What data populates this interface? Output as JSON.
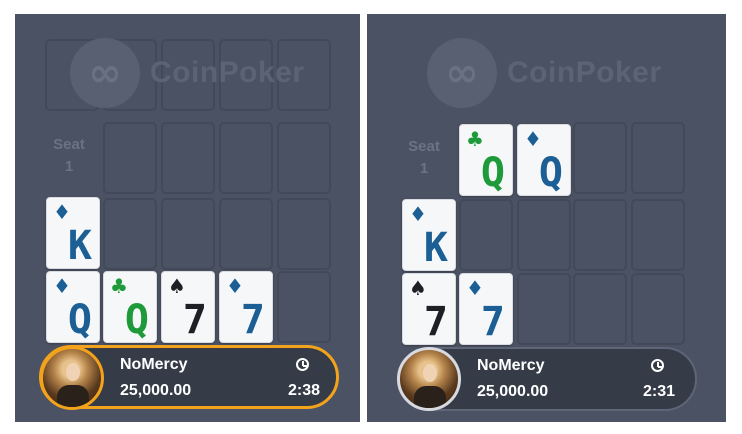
{
  "brand": {
    "name": "CoinPoker",
    "logo_icon": "coinpoker-logo-icon"
  },
  "panels": [
    {
      "seat_label": "Seat 1",
      "seat_label_line1": "Seat",
      "seat_label_line2": "1",
      "board": [],
      "cards": {
        "top": [
          {
            "rank": "K",
            "suit": "♦"
          }
        ],
        "bottom": [
          {
            "rank": "Q",
            "suit": "♦"
          },
          {
            "rank": "Q",
            "suit": "♣"
          },
          {
            "rank": "7",
            "suit": "♠"
          },
          {
            "rank": "7",
            "suit": "♦"
          }
        ]
      },
      "player": {
        "name": "NoMercy",
        "stack": "25,000.00",
        "timer": "2:38",
        "timer_icon": "clock-icon",
        "active": true
      }
    },
    {
      "seat_label_line1": "Seat",
      "seat_label_line2": "1",
      "board": [
        {
          "rank": "Q",
          "suit": "♣"
        },
        {
          "rank": "Q",
          "suit": "♦"
        }
      ],
      "cards": {
        "top": [
          {
            "rank": "K",
            "suit": "♦"
          }
        ],
        "bottom": [
          {
            "rank": "7",
            "suit": "♠"
          },
          {
            "rank": "7",
            "suit": "♦"
          }
        ]
      },
      "player": {
        "name": "NoMercy",
        "stack": "25,000.00",
        "timer": "2:31",
        "timer_icon": "clock-icon",
        "active": false
      }
    }
  ],
  "colors": {
    "panel_bg": "#4b5263",
    "active_ring": "#f2a31b",
    "diamond": "#1b5f95",
    "club": "#1f9a3a",
    "spade": "#1d1f24"
  }
}
